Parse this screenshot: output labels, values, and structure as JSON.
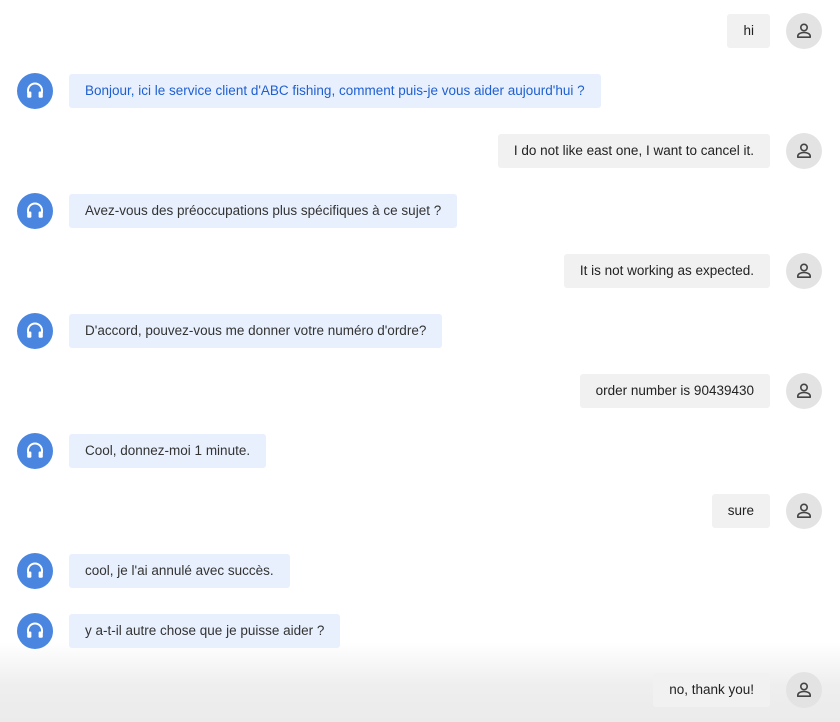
{
  "conversation": {
    "messages": [
      {
        "sender": "user",
        "text": "hi"
      },
      {
        "sender": "bot",
        "text": "Bonjour, ici le service client d'ABC fishing, comment puis-je vous aider aujourd'hui ?"
      },
      {
        "sender": "user",
        "text": "I do not like east one, I want to cancel it."
      },
      {
        "sender": "bot",
        "text": "Avez-vous des préoccupations plus spécifiques à ce sujet ?"
      },
      {
        "sender": "user",
        "text": "It is not working as expected."
      },
      {
        "sender": "bot",
        "text": "D'accord, pouvez-vous me donner votre numéro d'ordre?"
      },
      {
        "sender": "user",
        "text": "order number is 90439430"
      },
      {
        "sender": "bot",
        "text": "Cool, donnez-moi 1 minute."
      },
      {
        "sender": "user",
        "text": "sure"
      },
      {
        "sender": "bot",
        "text": "cool, je l'ai annulé avec succès."
      },
      {
        "sender": "bot",
        "text": "y a-t-il autre chose que je puisse aider ?"
      },
      {
        "sender": "user",
        "text": "no, thank you!"
      }
    ]
  },
  "icons": {
    "user_avatar": "person-icon",
    "bot_avatar": "headset-icon"
  },
  "colors": {
    "bot_avatar_bg": "#4a86e0",
    "bot_bubble_bg": "#e8f0fe",
    "user_avatar_bg": "#e3e3e3",
    "user_bubble_bg": "#f1f1f1",
    "highlight_text": "#1f5fcf"
  }
}
